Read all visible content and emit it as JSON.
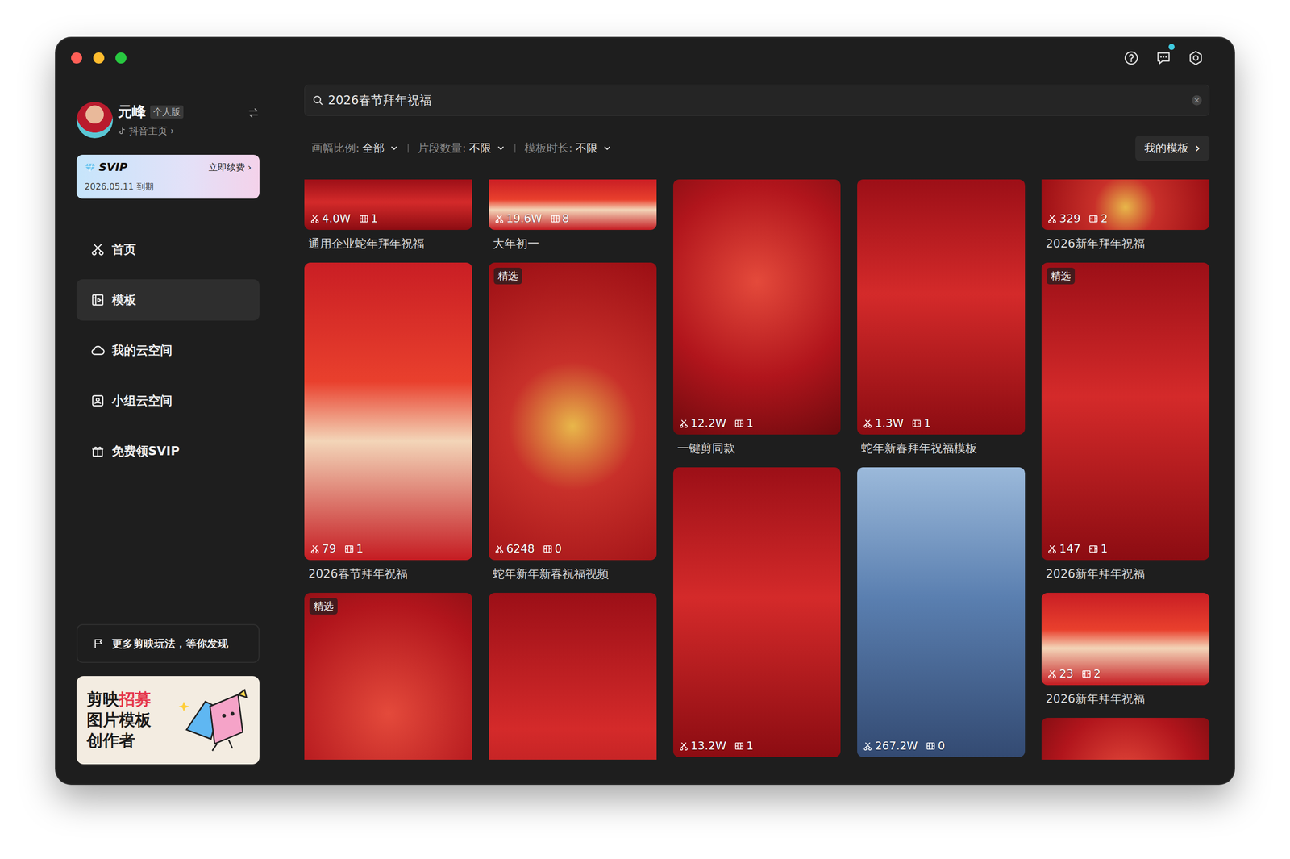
{
  "header": {
    "unread": true
  },
  "user": {
    "name": "元峰",
    "plan": "个人版",
    "link": "抖音主页 ›"
  },
  "svip": {
    "title": "SVIP",
    "action": "立即续费 ›",
    "expiry": "2026.05.11 到期"
  },
  "nav": [
    {
      "label": "首页",
      "selected": false,
      "kind": "home"
    },
    {
      "label": "模板",
      "selected": true,
      "kind": "template"
    },
    {
      "label": "我的云空间",
      "selected": false,
      "kind": "cloud"
    },
    {
      "label": "小组云空间",
      "selected": false,
      "kind": "group"
    },
    {
      "label": "免费领SVIP",
      "selected": false,
      "kind": "gift"
    }
  ],
  "promo": {
    "label": "更多剪映玩法，等你发现"
  },
  "banner": {
    "lines": [
      [
        "剪映",
        "招募"
      ],
      [
        "图片模板"
      ],
      [
        "创作者"
      ]
    ]
  },
  "search": {
    "value": "2026春节拜年祝福",
    "clear": "×"
  },
  "filters": [
    {
      "label": "画幅比例:",
      "value": "全部"
    },
    {
      "label": "片段数量:",
      "value": "不限"
    },
    {
      "label": "模板时长:",
      "value": "不限"
    }
  ],
  "my_templates": {
    "label": "我的模板",
    "arrow": "›"
  },
  "featured_label": "精选",
  "columns": [
    {
      "cards": [
        {
          "title": "通用企业蛇年拜年祝福",
          "uses": "4.0W",
          "clips": "1",
          "featured": false
        },
        {
          "title": "2026春节拜年祝福",
          "uses": "79",
          "clips": "1",
          "featured": false
        },
        {
          "featured": true
        }
      ]
    },
    {
      "cards": [
        {
          "title": "大年初一",
          "uses": "19.6W",
          "clips": "8",
          "featured": false
        },
        {
          "title": "蛇年新年新春祝福视频",
          "uses": "6248",
          "clips": "0",
          "featured": true
        },
        {
          "featured": false
        }
      ]
    },
    {
      "cards": [
        {
          "title": "一键剪同款",
          "uses": "12.2W",
          "clips": "1",
          "featured": false
        },
        {
          "uses": "13.2W",
          "clips": "1",
          "featured": false
        }
      ]
    },
    {
      "cards": [
        {
          "title": "蛇年新春拜年祝福模板",
          "uses": "1.3W",
          "clips": "1",
          "featured": false
        },
        {
          "uses": "267.2W",
          "clips": "0",
          "featured": false
        }
      ]
    },
    {
      "cards": [
        {
          "title": "2026新年拜年祝福",
          "uses": "329",
          "clips": "2",
          "featured": false
        },
        {
          "title": "2026新年拜年祝福",
          "uses": "147",
          "clips": "1",
          "featured": true
        },
        {
          "title": "2026新年拜年祝福",
          "uses": "23",
          "clips": "2",
          "featured": false
        },
        {
          "featured": false
        }
      ]
    }
  ]
}
